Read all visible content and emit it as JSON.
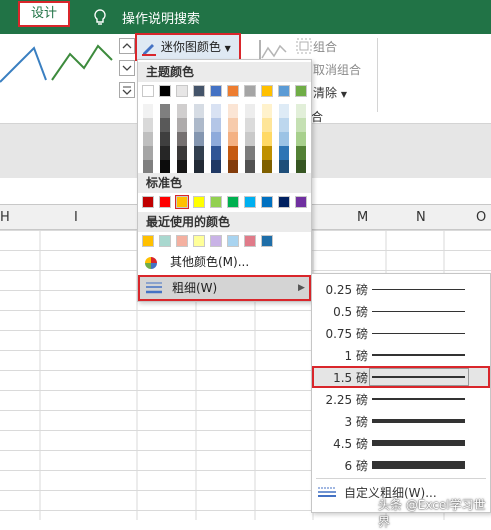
{
  "ribbon": {
    "tabs": {
      "design": "设计"
    },
    "tell_me": "操作说明搜索",
    "spark_color_button": "迷你图颜色",
    "group": "组合",
    "ungroup": "取消组合",
    "clear": "清除",
    "combine_suffix": "合"
  },
  "columns": [
    "H",
    "I",
    "M",
    "N",
    "O"
  ],
  "color_menu": {
    "theme_header": "主题颜色",
    "standard_header": "标准色",
    "recent_header": "最近使用的颜色",
    "more_colors": "其他颜色(M)...",
    "weight": "粗细(W)",
    "theme_colors": [
      "#ffffff",
      "#000000",
      "#e7e6e6",
      "#44546a",
      "#4472c4",
      "#ed7d31",
      "#a5a5a5",
      "#ffc000",
      "#5b9bd5",
      "#70ad47"
    ],
    "theme_tints": [
      [
        "#f2f2f2",
        "#7f7f7f",
        "#d0cece",
        "#d6dce4",
        "#d9e2f3",
        "#fbe5d5",
        "#ededed",
        "#fff2cc",
        "#deebf6",
        "#e2efd9"
      ],
      [
        "#d9d9d9",
        "#595959",
        "#aeabab",
        "#adb9ca",
        "#b4c6e7",
        "#f7cbac",
        "#dbdbdb",
        "#fee599",
        "#bdd7ee",
        "#c5e0b3"
      ],
      [
        "#bfbfbf",
        "#3f3f3f",
        "#757070",
        "#8496b0",
        "#8eaadb",
        "#f4b183",
        "#c9c9c9",
        "#ffd965",
        "#9cc3e5",
        "#a8d08d"
      ],
      [
        "#a5a5a5",
        "#262626",
        "#3a3838",
        "#323f4f",
        "#2f5496",
        "#c55a11",
        "#7b7b7b",
        "#bf9000",
        "#2e75b5",
        "#538135"
      ],
      [
        "#7f7f7f",
        "#0c0c0c",
        "#171616",
        "#222a35",
        "#1f3864",
        "#833c0b",
        "#525252",
        "#7f6000",
        "#1e4e79",
        "#375623"
      ]
    ],
    "standard_colors": [
      "#c00000",
      "#ff0000",
      "#ffc000",
      "#ffff00",
      "#92d050",
      "#00b050",
      "#00b0f0",
      "#0070c0",
      "#002060",
      "#7030a0"
    ],
    "recent_colors": [
      "#ffc000",
      "#a9d8cf",
      "#f4b0a0",
      "#ffff99",
      "#c9b3e6",
      "#a9d4f0",
      "#e07b89",
      "#1f6ea8"
    ]
  },
  "weight_menu": {
    "items": [
      {
        "label": "0.25 磅",
        "weight": 0.25
      },
      {
        "label": "0.5 磅",
        "weight": 0.5
      },
      {
        "label": "0.75 磅",
        "weight": 0.75
      },
      {
        "label": "1 磅",
        "weight": 1
      },
      {
        "label": "1.5 磅",
        "weight": 1.5
      },
      {
        "label": "2.25 磅",
        "weight": 2.25
      },
      {
        "label": "3 磅",
        "weight": 3
      },
      {
        "label": "4.5 磅",
        "weight": 4.5
      },
      {
        "label": "6 磅",
        "weight": 6
      }
    ],
    "selected_label": "1.5 磅",
    "custom": "自定义粗细(W)..."
  },
  "watermark": "头条 @Excel学习世界",
  "colors": {
    "accent": "#217346",
    "highlight": "#d9262b",
    "spark": "#3a7fc1",
    "spark_green": "#3d8b3d"
  }
}
